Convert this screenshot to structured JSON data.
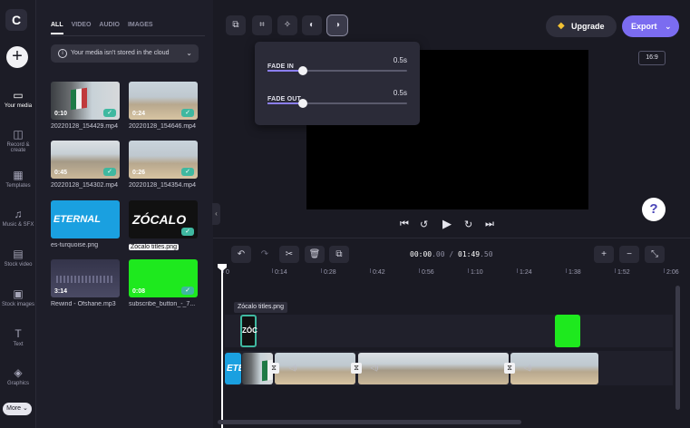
{
  "rail": {
    "logo": "C",
    "items": [
      {
        "label": "Your media",
        "icon": "folder-icon",
        "glyph": "▭"
      },
      {
        "label": "Record & create",
        "icon": "camera-icon",
        "glyph": "◫"
      },
      {
        "label": "Templates",
        "icon": "templates-icon",
        "glyph": "▦"
      },
      {
        "label": "Music & SFX",
        "icon": "music-icon",
        "glyph": "♫"
      },
      {
        "label": "Stock video",
        "icon": "film-icon",
        "glyph": "▤"
      },
      {
        "label": "Stock images",
        "icon": "image-icon",
        "glyph": "▣"
      },
      {
        "label": "Text",
        "icon": "text-icon",
        "glyph": "T"
      },
      {
        "label": "Graphics",
        "icon": "graphics-icon",
        "glyph": "◈"
      }
    ],
    "more": "More ⌄"
  },
  "media": {
    "tabs": [
      "ALL",
      "VIDEO",
      "AUDIO",
      "IMAGES"
    ],
    "active_tab": "ALL",
    "notice": "Your media isn't stored in the cloud",
    "items": [
      {
        "name": "20220128_154429.mp4",
        "duration": "0:10",
        "kind": "flag"
      },
      {
        "name": "20220128_154646.mp4",
        "duration": "0:24",
        "kind": "plaza"
      },
      {
        "name": "20220128_154302.mp4",
        "duration": "0:45",
        "kind": "plaza2"
      },
      {
        "name": "20220128_154354.mp4",
        "duration": "0:26",
        "kind": "plaza"
      },
      {
        "name": "es-turquoise.png",
        "duration": "",
        "kind": "eternal",
        "thumb_text": "ETERNAL SPRING"
      },
      {
        "name": "Zócalo titles.png",
        "duration": "",
        "kind": "zocalo",
        "thumb_text": "ZÓCALO"
      },
      {
        "name": "Rewind - Ofshane.mp3",
        "duration": "3:14",
        "kind": "audio"
      },
      {
        "name": "subscribe_button_-_7...",
        "duration": "0:08",
        "kind": "green"
      }
    ]
  },
  "fade": {
    "fade_in": {
      "label": "FADE IN",
      "value": "0.5s",
      "fraction": 0.25
    },
    "fade_out": {
      "label": "FADE OUT",
      "value": "0.5s",
      "fraction": 0.25
    }
  },
  "header": {
    "upgrade": "Upgrade",
    "export": "Export",
    "ratio": "16:9",
    "help": "?"
  },
  "timeline": {
    "timecode_current": "00:00",
    "timecode_current_frac": ".00",
    "timecode_total": "01:49",
    "timecode_total_frac": ".50",
    "ticks": [
      "0",
      "0:14",
      "0:28",
      "0:42",
      "0:56",
      "1:10",
      "1:24",
      "1:38",
      "1:52",
      "2:06"
    ],
    "clip_label": "Zócalo titles.png",
    "overlay_clip_text": "ZÓC",
    "main_clip_text": "ETER"
  }
}
